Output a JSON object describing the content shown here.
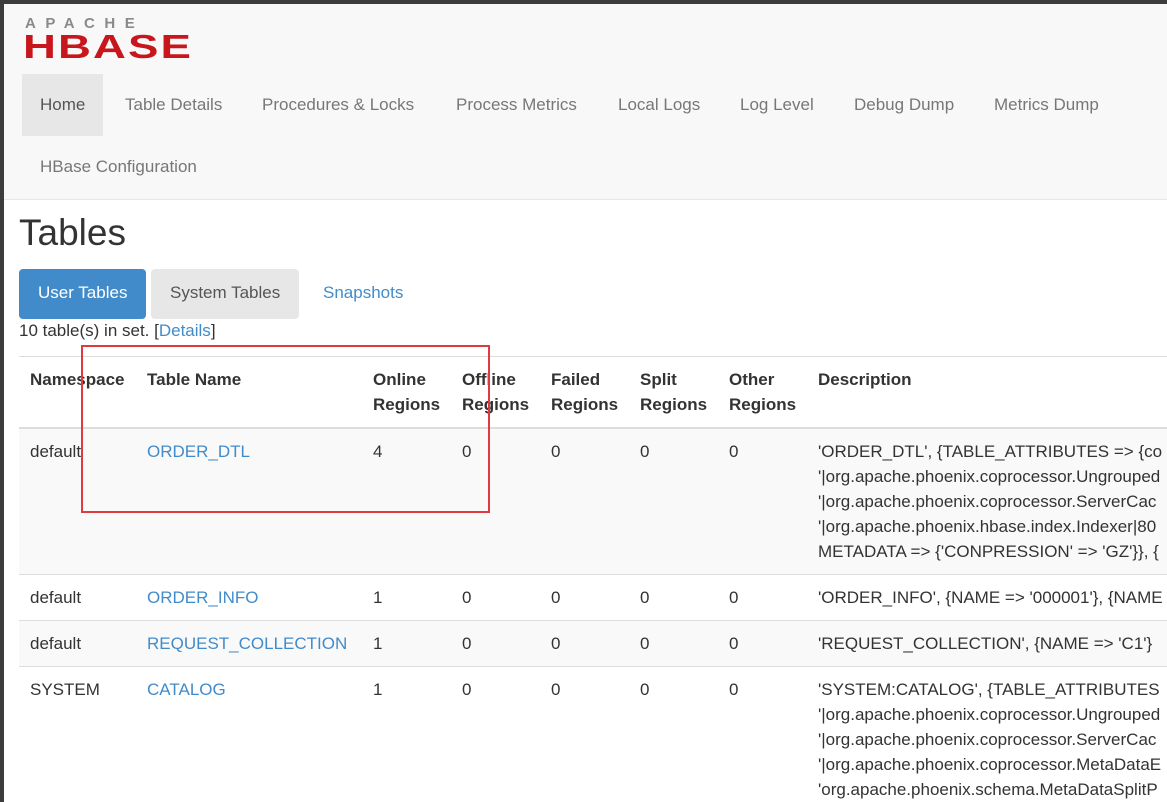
{
  "brand": {
    "top": "APACHE",
    "name": "HBASE"
  },
  "nav": {
    "items": [
      {
        "label": "Home",
        "active": true
      },
      {
        "label": "Table Details"
      },
      {
        "label": "Procedures & Locks"
      },
      {
        "label": "Process Metrics"
      },
      {
        "label": "Local Logs"
      },
      {
        "label": "Log Level"
      },
      {
        "label": "Debug Dump"
      },
      {
        "label": "Metrics Dump"
      },
      {
        "label": "HBase Configuration"
      }
    ]
  },
  "page": {
    "title": "Tables"
  },
  "tabs": [
    {
      "label": "User Tables",
      "active": true
    },
    {
      "label": "System Tables"
    },
    {
      "label": "Snapshots"
    }
  ],
  "summary": {
    "prefix": "10 table(s) in set. [",
    "link": "Details",
    "suffix": "]"
  },
  "table": {
    "headers": {
      "namespace": "Namespace",
      "table_name": "Table Name",
      "online_1": "Online",
      "online_2": "Regions",
      "offline_1": "Offline",
      "offline_2": "Regions",
      "failed_1": "Failed",
      "failed_2": "Regions",
      "split_1": "Split",
      "split_2": "Regions",
      "other_1": "Other",
      "other_2": "Regions",
      "description": "Description"
    },
    "rows": [
      {
        "namespace": "default",
        "name": "ORDER_DTL",
        "online": "4",
        "offline": "0",
        "failed": "0",
        "split": "0",
        "other": "0",
        "desc": [
          "'ORDER_DTL', {TABLE_ATTRIBUTES => {co",
          "'|org.apache.phoenix.coprocessor.Ungrouped",
          "'|org.apache.phoenix.coprocessor.ServerCac",
          "'|org.apache.phoenix.hbase.index.Indexer|80",
          "METADATA => {'CONPRESSION' => 'GZ'}}, {"
        ]
      },
      {
        "namespace": "default",
        "name": "ORDER_INFO",
        "online": "1",
        "offline": "0",
        "failed": "0",
        "split": "0",
        "other": "0",
        "desc": [
          "'ORDER_INFO', {NAME => '000001'}, {NAME"
        ]
      },
      {
        "namespace": "default",
        "name": "REQUEST_COLLECTION",
        "online": "1",
        "offline": "0",
        "failed": "0",
        "split": "0",
        "other": "0",
        "desc": [
          "'REQUEST_COLLECTION', {NAME => 'C1'}"
        ]
      },
      {
        "namespace": "SYSTEM",
        "name": "CATALOG",
        "online": "1",
        "offline": "0",
        "failed": "0",
        "split": "0",
        "other": "0",
        "desc": [
          "'SYSTEM:CATALOG', {TABLE_ATTRIBUTES",
          "'|org.apache.phoenix.coprocessor.Ungrouped",
          "'|org.apache.phoenix.coprocessor.ServerCac",
          "'|org.apache.phoenix.coprocessor.MetaDataE",
          "'org.apache.phoenix.schema.MetaDataSplitP"
        ]
      }
    ]
  },
  "colors": {
    "accent": "#428bca",
    "logo_red": "#c8161d",
    "highlight": "#e0393e"
  }
}
